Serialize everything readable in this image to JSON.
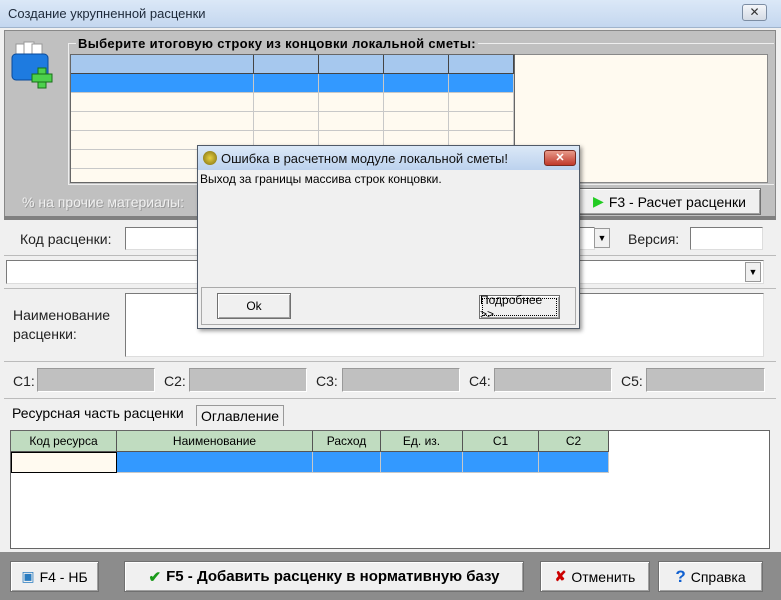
{
  "window": {
    "title": "Создание укрупненной расценки",
    "close": "✕"
  },
  "top": {
    "legend": "Выберите итоговую строку из концовки локальной сметы:",
    "materials_label": "% на прочие материалы:",
    "f3_label": "F3 - Расчет расценки"
  },
  "form": {
    "code_label": "Код расценки:",
    "version_label": "Версия:",
    "name_label_1": "Наименование",
    "name_label_2": "расценки:",
    "c_labels": [
      "C1:",
      "C2:",
      "C3:",
      "C4:",
      "C5:"
    ]
  },
  "tabs": [
    "Ресурсная часть расценки",
    "Оглавление"
  ],
  "resource_grid": {
    "headers": [
      "Код ресурса",
      "Наименование",
      "Расход",
      "Ед. из.",
      "C1",
      "C2"
    ]
  },
  "buttons": {
    "f4": "F4 - НБ",
    "f5": "F5 - Добавить расценку в нормативную базу",
    "cancel": "Отменить",
    "help": "Справка"
  },
  "dialog": {
    "title": "Ошибка в расчетном модуле локальной сметы!",
    "message": "Выход за границы массива строк концовки.",
    "ok": "Ok",
    "details": "Подробнее >>"
  }
}
